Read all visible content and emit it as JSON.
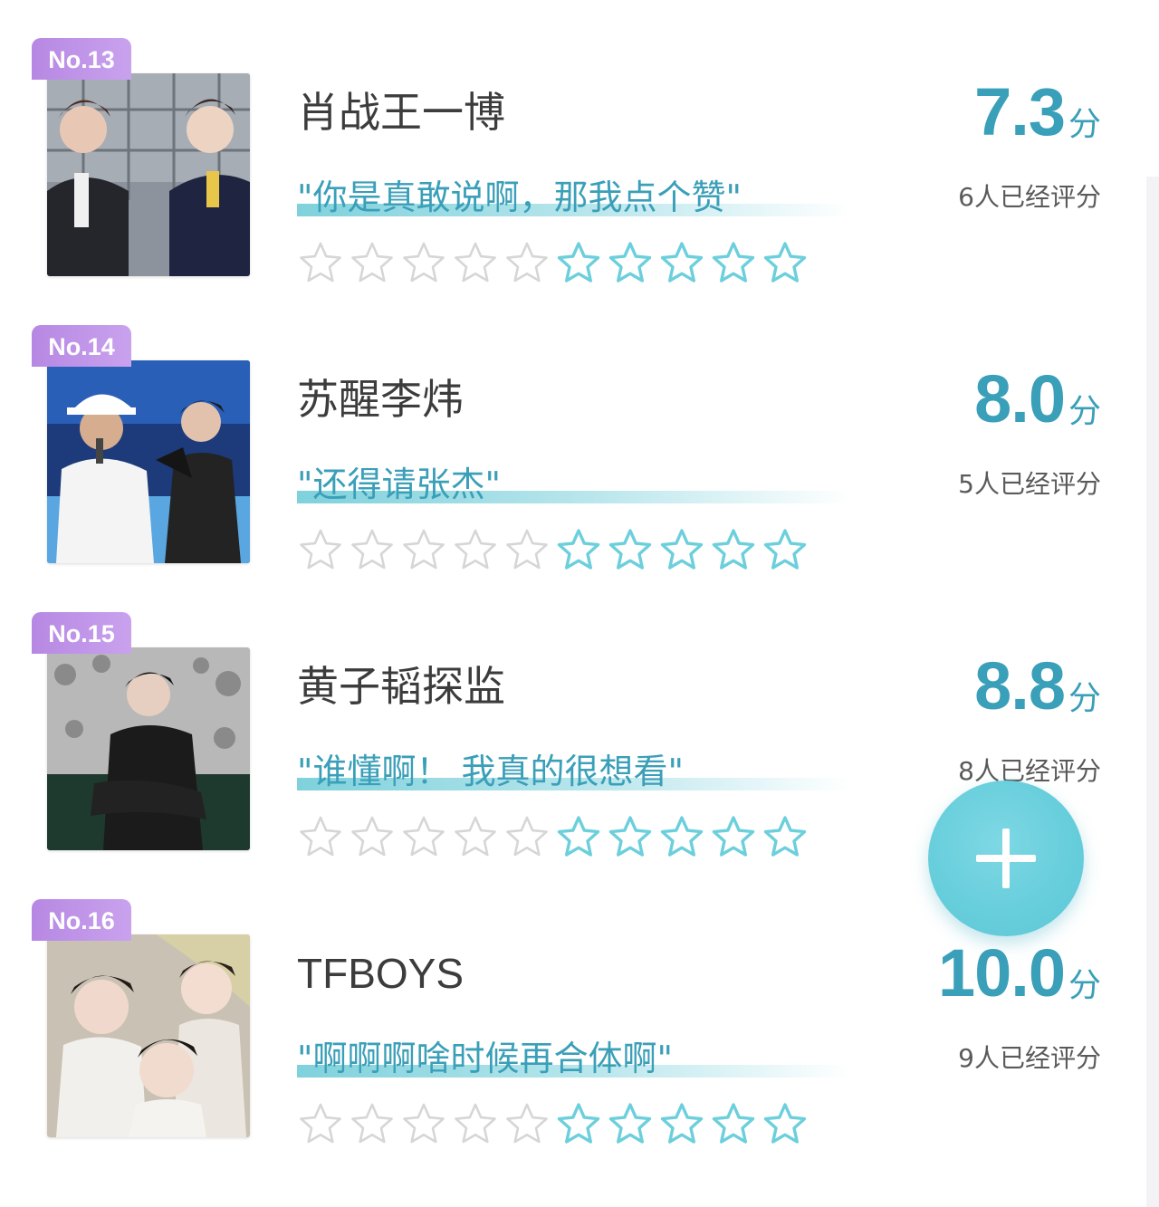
{
  "entries": [
    {
      "rank": "No.13",
      "name": "肖战王一博",
      "quote": "\"你是真敢说啊，那我点个赞\"",
      "score": "7.3",
      "unit": "分",
      "raters": "6人已经评分",
      "stars_total": 10,
      "stars_highlighted": 5,
      "thumb_icon": "two-performers-photo"
    },
    {
      "rank": "No.14",
      "name": "苏醒李炜",
      "quote": "\"还得请张杰\"",
      "score": "8.0",
      "unit": "分",
      "raters": "5人已经评分",
      "stars_total": 10,
      "stars_highlighted": 5,
      "thumb_icon": "two-singers-photo"
    },
    {
      "rank": "No.15",
      "name": "黄子韬探监",
      "quote": "\"谁懂啊！ 我真的很想看\"",
      "score": "8.8",
      "unit": "分",
      "raters": "8人已经评分",
      "stars_total": 10,
      "stars_highlighted": 5,
      "thumb_icon": "seated-person-photo"
    },
    {
      "rank": "No.16",
      "name": "TFBOYS",
      "quote": "\"啊啊啊啥时候再合体啊\"",
      "score": "10.0",
      "unit": "分",
      "raters": "9人已经评分",
      "stars_total": 10,
      "stars_highlighted": 5,
      "thumb_icon": "three-person-group-photo"
    }
  ],
  "colors": {
    "accent": "#3a9fb8",
    "star_active": "#6ccfdc",
    "star_inactive": "#d6d6d6",
    "badge": "#b788e3",
    "fab": "#66cddb"
  },
  "fab": {
    "icon": "plus-icon"
  }
}
